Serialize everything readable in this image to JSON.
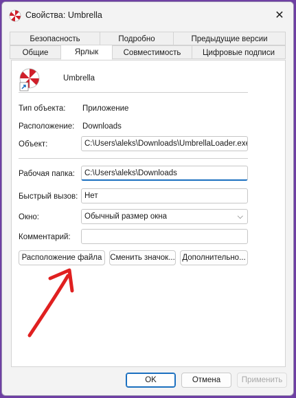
{
  "window": {
    "title": "Свойства: Umbrella",
    "close_glyph": "✕"
  },
  "tabs": {
    "row1": [
      "Безопасность",
      "Подробно",
      "Предыдущие версии"
    ],
    "row2": [
      "Общие",
      "Ярлык",
      "Совместимость",
      "Цифровые подписи"
    ],
    "active": "Ярлык"
  },
  "shortcut": {
    "name": "Umbrella",
    "type_label": "Тип объекта:",
    "type_value": "Приложение",
    "location_label": "Расположение:",
    "location_value": "Downloads",
    "target_label": "Объект:",
    "target_value": "C:\\Users\\aleks\\Downloads\\UmbrellaLoader.exe",
    "start_in_label": "Рабочая папка:",
    "start_in_value": "C:\\Users\\aleks\\Downloads",
    "hotkey_label": "Быстрый вызов:",
    "hotkey_value": "Нет",
    "run_label": "Окно:",
    "run_value": "Обычный размер окна",
    "comment_label": "Комментарий:",
    "comment_value": ""
  },
  "buttons": {
    "open_location": "Расположение файла",
    "change_icon": "Сменить значок...",
    "advanced": "Дополнительно...",
    "ok": "OK",
    "cancel": "Отмена",
    "apply": "Применить"
  },
  "colors": {
    "accent": "#1a6fbf",
    "annotation_arrow": "#e02020",
    "umbrella_red": "#d01f2a"
  },
  "icons": {
    "app": "umbrella-logo-icon",
    "shortcut_overlay": "shortcut-arrow-icon",
    "dropdown": "chevron-down-icon"
  }
}
